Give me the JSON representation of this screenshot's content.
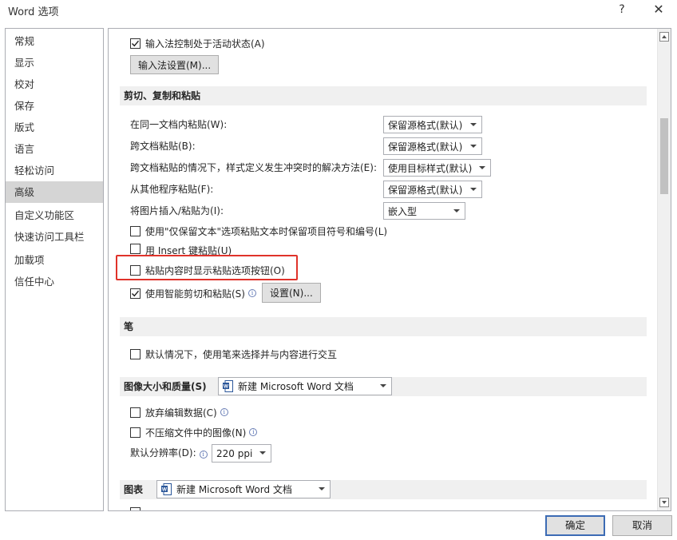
{
  "window": {
    "title": "Word 选项",
    "help": "?",
    "close": "✕"
  },
  "nav": {
    "items": [
      "常规",
      "显示",
      "校对",
      "保存",
      "版式",
      "语言",
      "轻松访问",
      "高级",
      "自定义功能区",
      "快速访问工具栏",
      "加载项",
      "信任中心"
    ],
    "selected": "高级"
  },
  "ime": {
    "active_label": "输入法控制处于活动状态(A)",
    "settings_button": "输入法设置(M)..."
  },
  "clipboard": {
    "heading": "剪切、复制和粘贴",
    "paste_within": {
      "label": "在同一文档内粘贴(W):",
      "value": "保留源格式(默认)"
    },
    "paste_between": {
      "label": "跨文档粘贴(B):",
      "value": "保留源格式(默认)"
    },
    "paste_conflict": {
      "label": "跨文档粘贴的情况下，样式定义发生冲突时的解决方法(E):",
      "value": "使用目标样式(默认)"
    },
    "paste_other": {
      "label": "从其他程序粘贴(F):",
      "value": "保留源格式(默认)"
    },
    "insert_picture": {
      "label": "将图片插入/粘贴为(I):",
      "value": "嵌入型"
    },
    "keep_bullets": "使用\"仅保留文本\"选项粘贴文本时保留项目符号和编号(L)",
    "insert_key": "用 Insert 键粘贴(U)",
    "show_paste_options": "粘贴内容时显示粘贴选项按钮(O)",
    "smart_cut": "使用智能剪切和粘贴(S)",
    "settings_button": "设置(N)..."
  },
  "pen": {
    "heading": "笔",
    "default_pen": "默认情况下，使用笔来选择并与内容进行交互"
  },
  "image_quality": {
    "heading": "图像大小和质量(S)",
    "doc_value": "新建 Microsoft Word 文档",
    "discard_edit": "放弃编辑数据(C)",
    "no_compress": "不压缩文件中的图像(N)",
    "resolution_label": "默认分辨率(D):",
    "resolution_value": "220 ppi"
  },
  "charts": {
    "heading": "图表",
    "doc_value": "新建 Microsoft Word 文档"
  },
  "footer": {
    "ok": "确定",
    "cancel": "取消"
  },
  "colors": {
    "highlight": "#e0322a",
    "accent": "#3c6bb4",
    "word_blue": "#2b579a"
  }
}
